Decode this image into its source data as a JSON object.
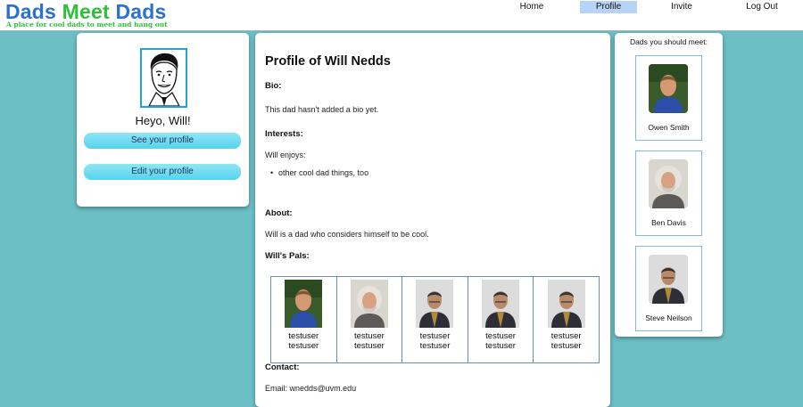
{
  "header": {
    "logo": {
      "w1": "Dads",
      "w2": "Meet",
      "w3": "Dads"
    },
    "tagline": "A place for cool dads to meet and hang out",
    "nav": [
      {
        "label": "Home"
      },
      {
        "label": "Profile",
        "active": true
      },
      {
        "label": "Invite"
      },
      {
        "label": "Log Out"
      }
    ]
  },
  "left": {
    "greeting": "Heyo, Will!",
    "see_profile": "See your profile",
    "edit_profile": "Edit your profile"
  },
  "profile": {
    "title": "Profile of Will Nedds",
    "bio_label": "Bio:",
    "bio": "This dad hasn't added a bio yet.",
    "interests_label": "Interests:",
    "interests_intro": "Will enjoys:",
    "interests": [
      "other cool dad things, too"
    ],
    "about_label": "About:",
    "about": "Will is a dad who considers himself to be cool.",
    "pals_label": "Will's Pals:",
    "pals": [
      {
        "first": "testuser",
        "last": "testuser",
        "photo": "young-man"
      },
      {
        "first": "testuser",
        "last": "testuser",
        "photo": "old-man-beard"
      },
      {
        "first": "testuser",
        "last": "testuser",
        "photo": "man-suit"
      },
      {
        "first": "testuser",
        "last": "testuser",
        "photo": "man-suit"
      },
      {
        "first": "testuser",
        "last": "testuser",
        "photo": "man-suit"
      }
    ],
    "contact_label": "Contact:",
    "email": "Email: wnedds@uvm.edu"
  },
  "suggestions": {
    "title": "Dads you should meet:",
    "items": [
      {
        "name": "Owen Smith",
        "photo": "young-man"
      },
      {
        "name": "Ben Davis",
        "photo": "old-man-beard"
      },
      {
        "name": "Steve Neilson",
        "photo": "man-suit"
      }
    ]
  },
  "colors": {
    "background": "#6bbfc5",
    "accent": "#2c6fd6",
    "logo_green": "#2fbf3a",
    "nav_active": "#b7d3f7",
    "pill": "#55d2ee"
  }
}
